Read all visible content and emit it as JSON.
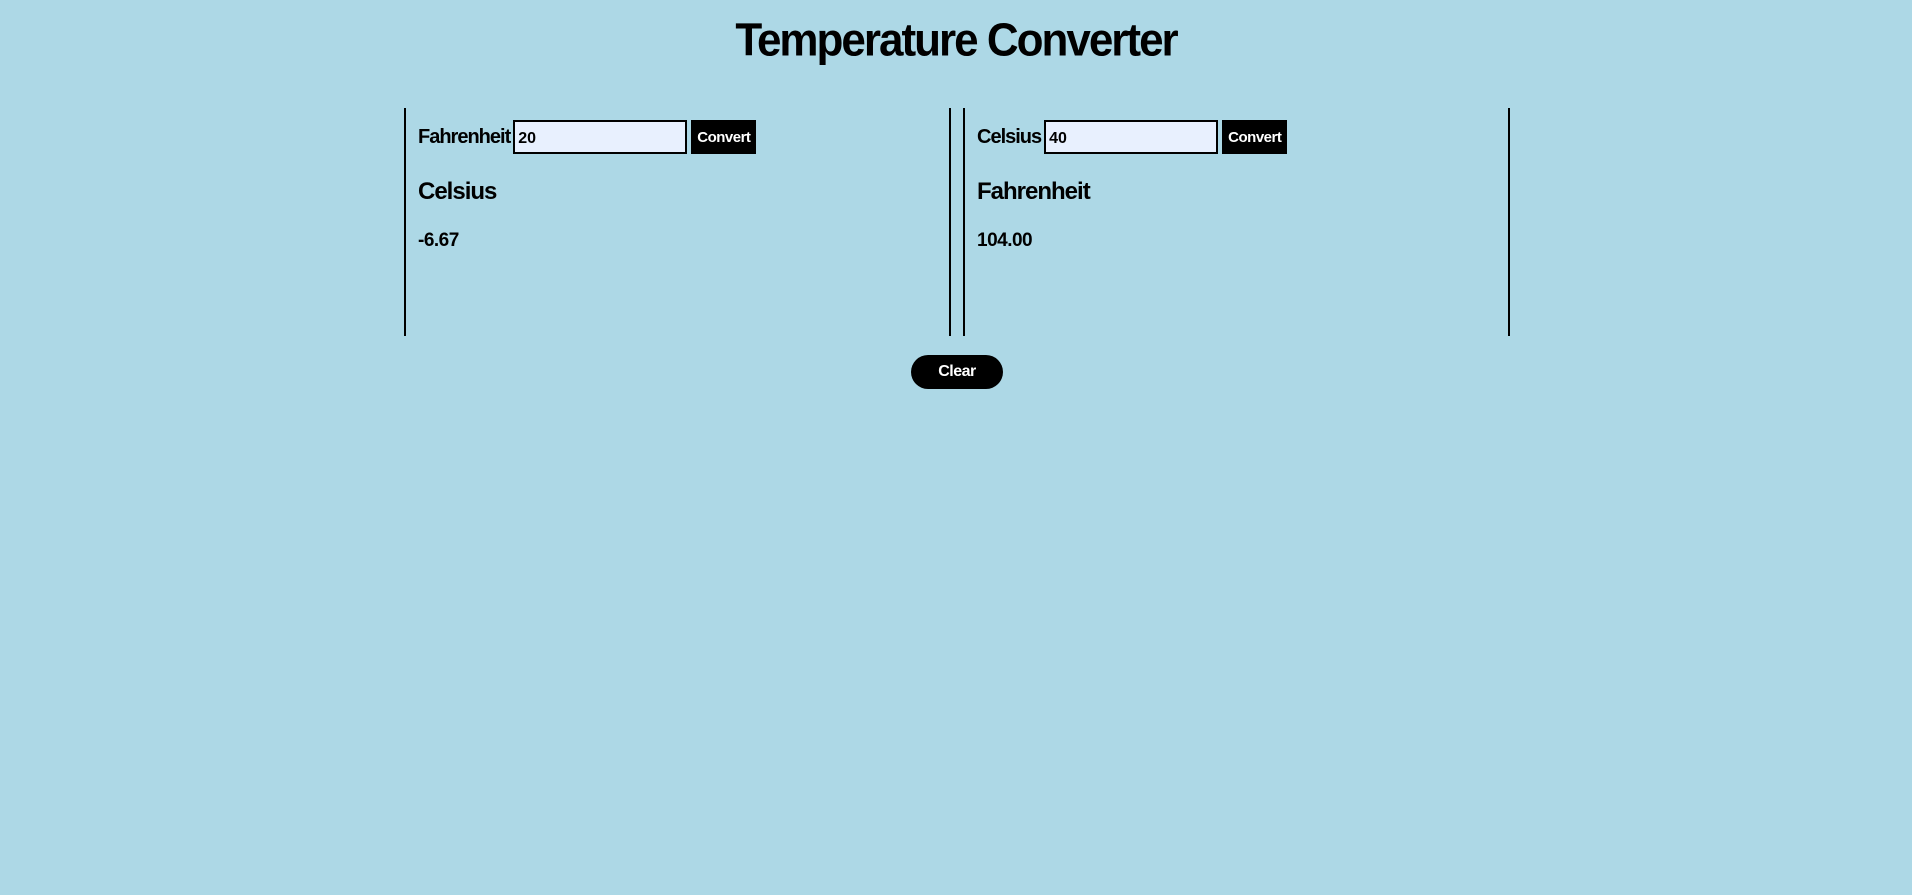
{
  "page": {
    "title": "Temperature Converter"
  },
  "fahrenheit_to_celsius": {
    "input_label": "Fahrenheit",
    "input_value": "20",
    "convert_label": "Convert",
    "result_heading": "Celsius",
    "result_value": "-6.67"
  },
  "celsius_to_fahrenheit": {
    "input_label": "Celsius",
    "input_value": "40",
    "convert_label": "Convert",
    "result_heading": "Fahrenheit",
    "result_value": "104.00"
  },
  "actions": {
    "clear_label": "Clear"
  },
  "colors": {
    "background": "#add8e6",
    "input_background": "#e8f0fe",
    "button_background": "#000000",
    "button_text": "#ffffff"
  }
}
